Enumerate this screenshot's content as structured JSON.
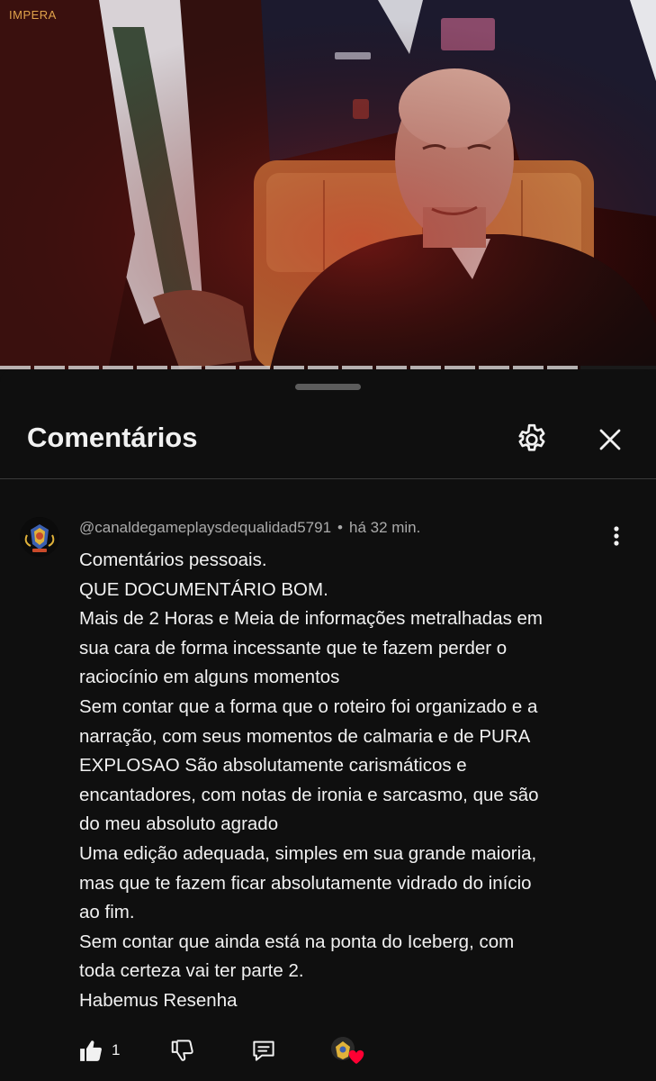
{
  "video": {
    "watermark": "IMPERA",
    "progress_fraction": 0.885
  },
  "panel": {
    "title": "Comentários",
    "settings_icon": "gear-icon",
    "close_icon": "close-icon"
  },
  "comment": {
    "author": "@canaldegameplaysdequalidad5791",
    "separator": "•",
    "time": "há 32 min.",
    "lines": [
      "Comentários pessoais.",
      "QUE DOCUMENTÁRIO BOM.",
      "Mais de 2 Horas e Meia de informações metralhadas em",
      "sua cara de forma incessante que te fazem perder o",
      "raciocínio em alguns momentos",
      "Sem contar que a forma que o roteiro foi organizado e a",
      "narração, com seus momentos de calmaria e de PURA",
      "EXPLOSAO São absolutamente carismáticos e",
      "encantadores, com notas de ironia e sarcasmo, que são",
      "do meu absoluto agrado",
      "Uma edição adequada, simples em sua grande maioria,",
      "mas que te fazem ficar absolutamente vidrado do início",
      "ao fim.",
      "Sem contar que ainda está na ponta do Iceberg, com",
      "toda certeza vai ter parte 2.",
      "Habemus Resenha"
    ],
    "like_count": "1",
    "icons": {
      "like": "thumbs-up-icon",
      "dislike": "thumbs-down-icon",
      "reply": "reply-icon",
      "creator_heart": "creator-heart-icon",
      "more": "more-vert-icon"
    }
  },
  "colors": {
    "background": "#0f0f0f",
    "text": "#f1f1f1",
    "secondary_text": "#aaaaaa",
    "heart": "#ff0033"
  }
}
